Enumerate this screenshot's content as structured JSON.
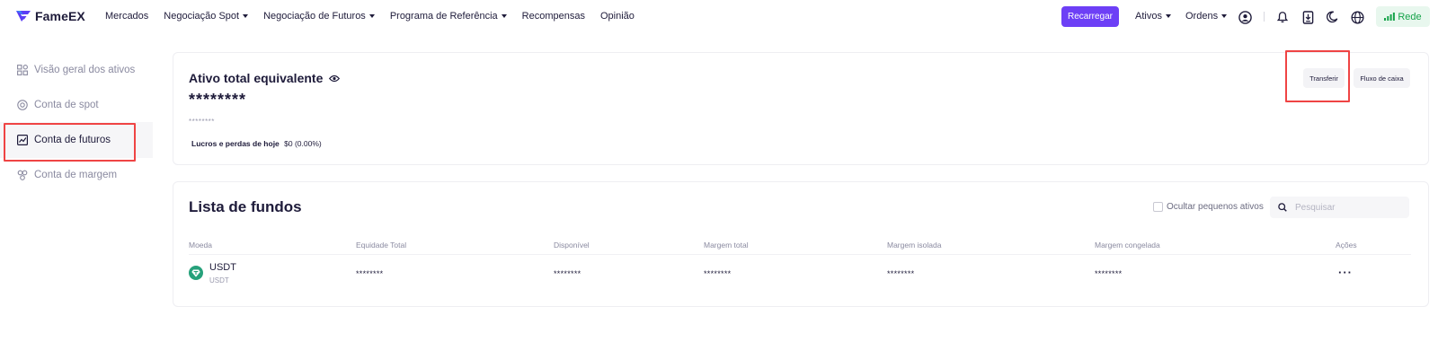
{
  "brand": {
    "name": "FameEX",
    "color": "#5b3df5"
  },
  "nav": {
    "items": [
      {
        "label": "Mercados",
        "dropdown": false
      },
      {
        "label": "Negociação Spot",
        "dropdown": true
      },
      {
        "label": "Negociação de Futuros",
        "dropdown": true
      },
      {
        "label": "Programa de Referência",
        "dropdown": true
      },
      {
        "label": "Recompensas",
        "dropdown": false
      },
      {
        "label": "Opinião",
        "dropdown": false
      }
    ]
  },
  "header_right": {
    "recharge_label": "Recarregar",
    "assets_label": "Ativos",
    "orders_label": "Ordens",
    "network_label": "Rede",
    "icons": [
      "user-icon",
      "bell-icon",
      "download-icon",
      "moon-icon",
      "globe-icon",
      "signal-icon"
    ]
  },
  "sidebar": {
    "items": [
      {
        "label": "Visão geral dos ativos",
        "icon": "grid-icon"
      },
      {
        "label": "Conta de spot",
        "icon": "target-icon"
      },
      {
        "label": "Conta de futuros",
        "icon": "chart-icon"
      },
      {
        "label": "Conta de margem",
        "icon": "people-icon"
      }
    ],
    "active_index": 2
  },
  "summary": {
    "title": "Ativo total equivalente",
    "value": "********",
    "sub_value": "********",
    "pnl_label": "Lucros e perdas de hoje",
    "pnl_value": "$0 (0.00%)",
    "transfer_label": "Transferir",
    "cashflow_label": "Fluxo de caixa"
  },
  "funds": {
    "title": "Lista de fundos",
    "hide_small_label": "Ocultar pequenos ativos",
    "search_placeholder": "Pesquisar",
    "columns": [
      "Moeda",
      "Equidade Total",
      "Disponível",
      "Margem total",
      "Margem isolada",
      "Margem congelada",
      "Ações"
    ],
    "rows": [
      {
        "coin": "USDT",
        "coin_sub": "USDT",
        "total_equity": "********",
        "available": "********",
        "total_margin": "********",
        "isolated_margin": "********",
        "frozen_margin": "********",
        "actions": "···"
      }
    ]
  },
  "colors": {
    "accent": "#6d3ff6",
    "highlight_box": "#ef4444",
    "network_green": "#16a34a",
    "usdt": "#26a17b"
  }
}
